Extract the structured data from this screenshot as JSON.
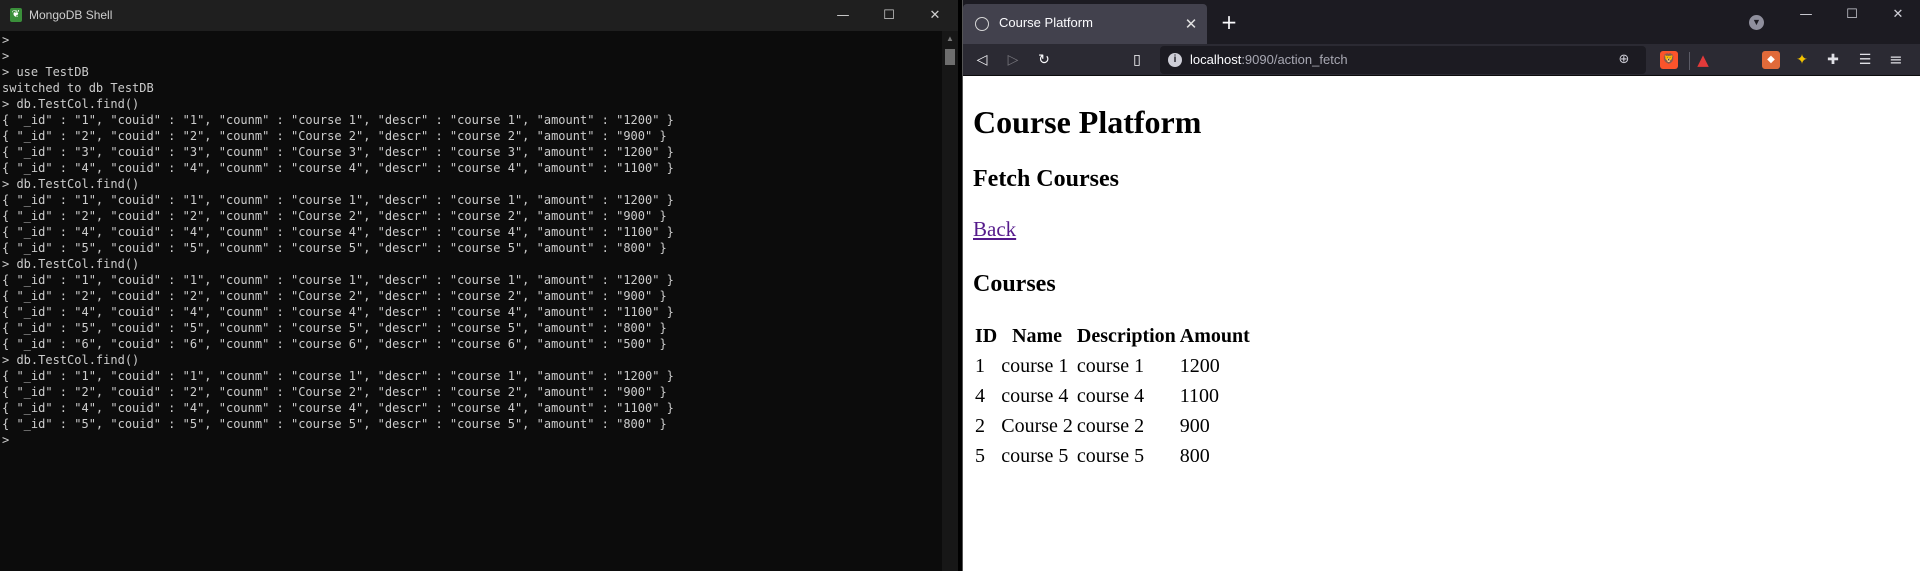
{
  "terminal": {
    "title": "MongoDB Shell",
    "controls": {
      "minimize": "—",
      "maximize": "☐",
      "close": "✕"
    },
    "lines": [
      ">",
      ">",
      "> use TestDB",
      "switched to db TestDB",
      "> db.TestCol.find()",
      "{ \"_id\" : \"1\", \"couid\" : \"1\", \"counm\" : \"course 1\", \"descr\" : \"course 1\", \"amount\" : \"1200\" }",
      "{ \"_id\" : \"2\", \"couid\" : \"2\", \"counm\" : \"Course 2\", \"descr\" : \"course 2\", \"amount\" : \"900\" }",
      "{ \"_id\" : \"3\", \"couid\" : \"3\", \"counm\" : \"Course 3\", \"descr\" : \"course 3\", \"amount\" : \"1200\" }",
      "{ \"_id\" : \"4\", \"couid\" : \"4\", \"counm\" : \"course 4\", \"descr\" : \"course 4\", \"amount\" : \"1100\" }",
      "> db.TestCol.find()",
      "{ \"_id\" : \"1\", \"couid\" : \"1\", \"counm\" : \"course 1\", \"descr\" : \"course 1\", \"amount\" : \"1200\" }",
      "{ \"_id\" : \"2\", \"couid\" : \"2\", \"counm\" : \"Course 2\", \"descr\" : \"course 2\", \"amount\" : \"900\" }",
      "{ \"_id\" : \"4\", \"couid\" : \"4\", \"counm\" : \"course 4\", \"descr\" : \"course 4\", \"amount\" : \"1100\" }",
      "{ \"_id\" : \"5\", \"couid\" : \"5\", \"counm\" : \"course 5\", \"descr\" : \"course 5\", \"amount\" : \"800\" }",
      "> db.TestCol.find()",
      "{ \"_id\" : \"1\", \"couid\" : \"1\", \"counm\" : \"course 1\", \"descr\" : \"course 1\", \"amount\" : \"1200\" }",
      "{ \"_id\" : \"2\", \"couid\" : \"2\", \"counm\" : \"Course 2\", \"descr\" : \"course 2\", \"amount\" : \"900\" }",
      "{ \"_id\" : \"4\", \"couid\" : \"4\", \"counm\" : \"course 4\", \"descr\" : \"course 4\", \"amount\" : \"1100\" }",
      "{ \"_id\" : \"5\", \"couid\" : \"5\", \"counm\" : \"course 5\", \"descr\" : \"course 5\", \"amount\" : \"800\" }",
      "{ \"_id\" : \"6\", \"couid\" : \"6\", \"counm\" : \"course 6\", \"descr\" : \"course 6\", \"amount\" : \"500\" }",
      "> db.TestCol.find()",
      "{ \"_id\" : \"1\", \"couid\" : \"1\", \"counm\" : \"course 1\", \"descr\" : \"course 1\", \"amount\" : \"1200\" }",
      "{ \"_id\" : \"2\", \"couid\" : \"2\", \"counm\" : \"Course 2\", \"descr\" : \"course 2\", \"amount\" : \"900\" }",
      "{ \"_id\" : \"4\", \"couid\" : \"4\", \"counm\" : \"course 4\", \"descr\" : \"course 4\", \"amount\" : \"1100\" }",
      "{ \"_id\" : \"5\", \"couid\" : \"5\", \"counm\" : \"course 5\", \"descr\" : \"course 5\", \"amount\" : \"800\" }",
      ">"
    ]
  },
  "browser": {
    "tab": {
      "title": "Course Platform",
      "icon": "globe-icon",
      "close": "✕"
    },
    "new_tab": "+",
    "controls": {
      "minimize": "—",
      "maximize": "☐",
      "close": "✕"
    },
    "nav": {
      "back": "◁",
      "forward": "▷",
      "reload": "↻",
      "bookmark": "▯"
    },
    "url": {
      "host": "localhost",
      "rest": ":9090/action_fetch"
    },
    "zoom_icon": "⊕",
    "menu": "≡"
  },
  "page": {
    "title": "Course Platform",
    "subtitle": "Fetch Courses",
    "back_link": "Back",
    "courses_heading": "Courses",
    "table": {
      "headers": [
        "ID",
        "Name",
        "Description",
        "Amount"
      ],
      "rows": [
        [
          "1",
          "course 1",
          "course 1",
          "1200"
        ],
        [
          "4",
          "course 4",
          "course 4",
          "1100"
        ],
        [
          "2",
          "Course 2",
          "course 2",
          "900"
        ],
        [
          "5",
          "course 5",
          "course 5",
          "800"
        ]
      ]
    }
  },
  "colors": {
    "terminal_bg": "#0c0c0c",
    "terminal_text": "#cccccc",
    "browser_chrome": "#2b2a33",
    "tab_active": "#42414d",
    "visited_link": "#551a8b"
  }
}
